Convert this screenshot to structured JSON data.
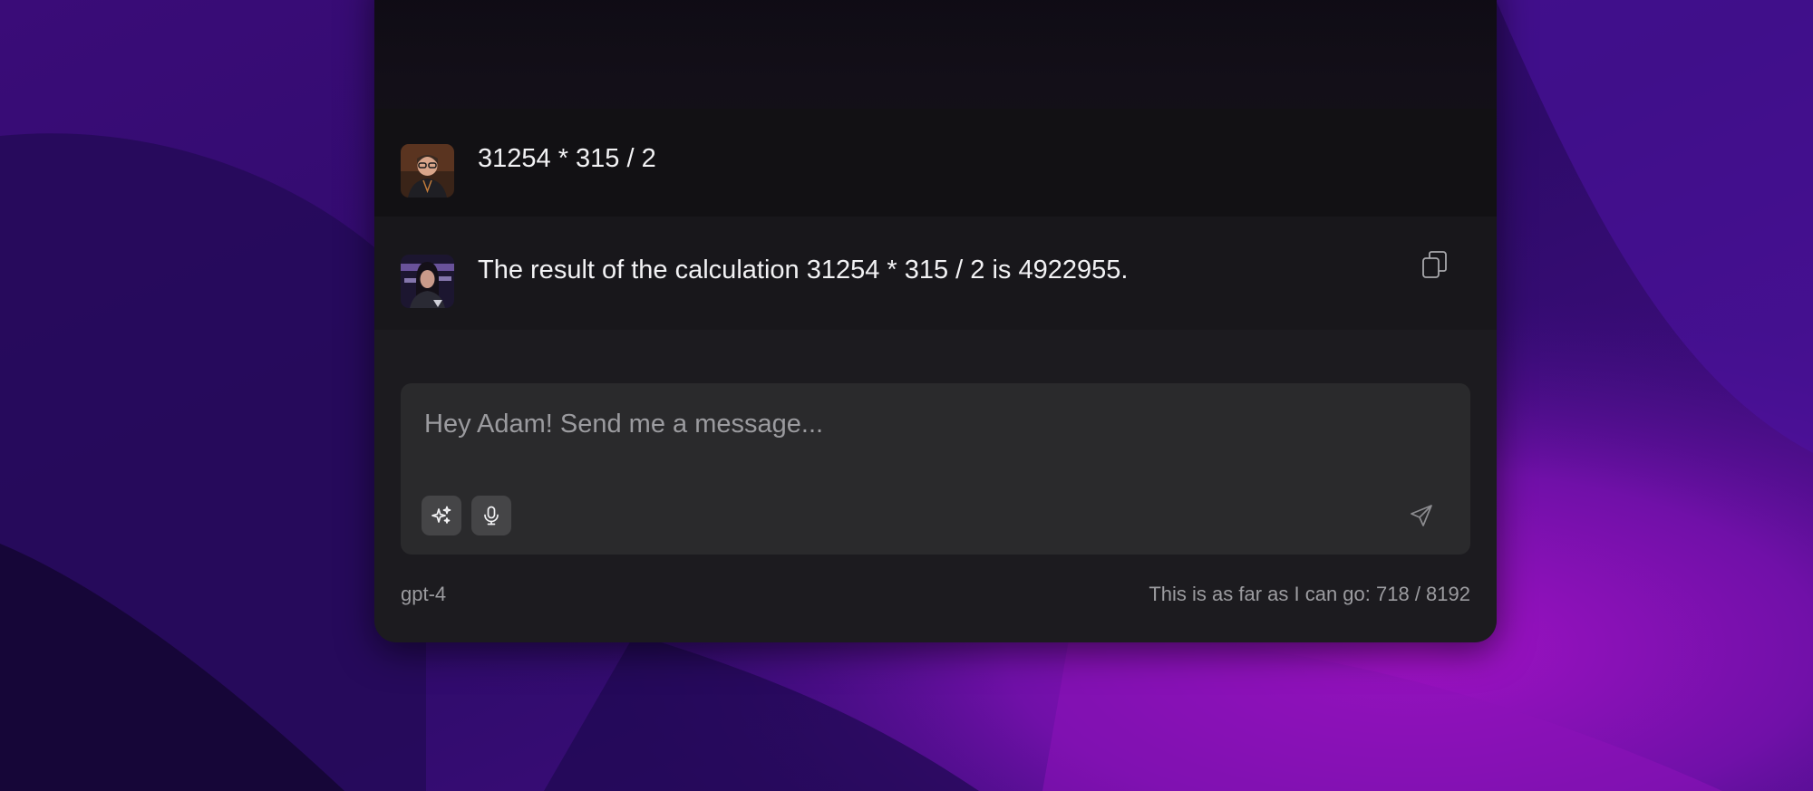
{
  "chat": {
    "messages": [
      {
        "role": "user",
        "text": "31254 * 315 / 2",
        "avatar_icon": "user-avatar"
      },
      {
        "role": "assistant",
        "text": "The result of the calculation 31254 * 315 / 2 is 4922955.",
        "avatar_icon": "assistant-avatar",
        "action_icon": "copy-icon"
      }
    ]
  },
  "composer": {
    "placeholder": "Hey Adam! Send me a message...",
    "value": "",
    "tools": [
      {
        "icon": "sparkles-icon"
      },
      {
        "icon": "microphone-icon"
      }
    ],
    "send_icon": "send-icon"
  },
  "footer": {
    "model": "gpt-4",
    "token_status": "This is as far as I can go: 718 / 8192"
  },
  "colors": {
    "window_bg": "#1c1b1f",
    "composer_bg": "#2a2a2c",
    "wallpaper_accent": "#8a12b8"
  }
}
